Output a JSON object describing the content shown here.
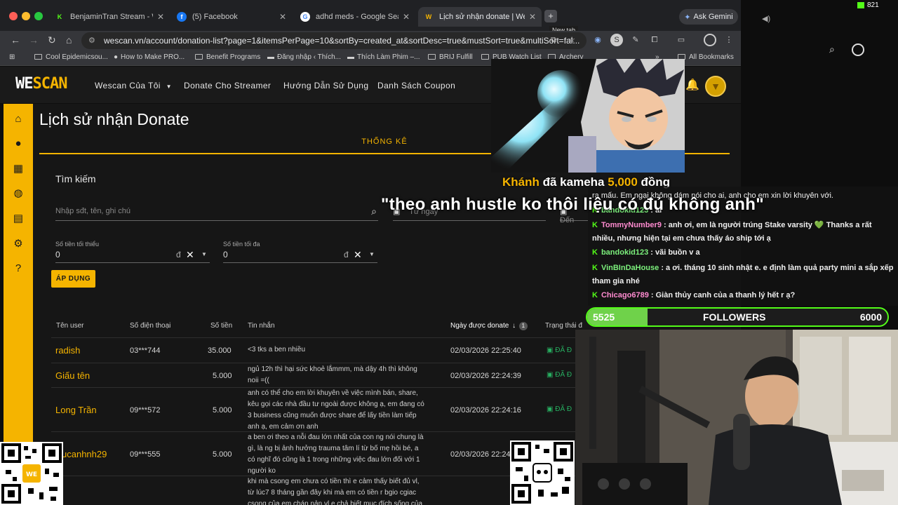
{
  "browser": {
    "tabs": [
      {
        "title": "BenjaminTran Stream - Watch",
        "favicon": "kick-icon",
        "color": "#53fc18"
      },
      {
        "title": "(5) Facebook",
        "favicon": "facebook-icon",
        "color": "#1877f2"
      },
      {
        "title": "adhd meds - Google Search",
        "favicon": "google-icon",
        "color": "#ffffff"
      },
      {
        "title": "Lịch sử nhận donate | WeScan",
        "favicon": "wescan-icon",
        "color": "#f5b400"
      }
    ],
    "new_tab_tooltip": "New tab",
    "gemini_label": "Ask Gemini",
    "url": "wescan.vn/account/donation-list?page=1&itemsPerPage=10&sortBy=created_at&sortDesc=true&mustSort=true&multiSort=fal...",
    "bookmarks": [
      "Cool Epidemicsou...",
      "How to Make PRO...",
      "Benefit Programs",
      "Đăng nhập ‹ Thích...",
      "Thích Làm Phim –...",
      "BRIJ Fulfill",
      "PUB Watch List",
      "Archery"
    ],
    "all_bookmarks": "All Bookmarks",
    "system_count": "821"
  },
  "site": {
    "logo_we": "WE",
    "logo_scan": "SCAN",
    "nav": [
      "Wescan Của Tôi",
      "Donate Cho Streamer",
      "Hướng Dẫn Sử Dụng",
      "Danh Sách Coupon"
    ],
    "page_title": "Lịch sử nhận Donate",
    "stats_tab": "THỐNG KÊ",
    "search_title": "Tìm kiếm",
    "search_placeholder": "Nhập sđt, tên, ghi chú",
    "from_date_placeholder": "Từ ngày",
    "to_date_placeholder": "Đến",
    "min_label": "Số tiền tối thiểu",
    "max_label": "Số tiền tối đa",
    "min_value": "0",
    "max_value": "0",
    "currency": "đ",
    "apply_label": "ÁP DỤNG",
    "columns": [
      "Tên user",
      "Số điện thoại",
      "Số tiền",
      "Tin nhắn",
      "Ngày được donate",
      "Trạng thái đ"
    ],
    "sort_badge": "1",
    "rows": [
      {
        "name": "radish",
        "phone": "03***744",
        "amount": "35.000",
        "message": [
          "<3 tks a ben nhiều"
        ],
        "date": "02/03/2026 22:25:40",
        "status": "ĐÃ Đ"
      },
      {
        "name": "Giấu tên",
        "phone": "",
        "amount": "5.000",
        "message": [
          "ngủ 12h thì hại sức khoẻ lắmmm, mà dậy 4h thì không",
          "noii =(("
        ],
        "date": "02/03/2026 22:24:39",
        "status": "ĐÃ Đ"
      },
      {
        "name": "Long Trần",
        "phone": "09***572",
        "amount": "5.000",
        "message": [
          "anh có thể cho em lời khuyên về việc mình bán, share,",
          "kêu gọi các nhà đầu tư ngoài được không ạ, em đang có",
          "3 business cũng muốn được share để lấy tiền làm tiếp",
          "anh ạ, em cảm ơn anh"
        ],
        "date": "02/03/2026 22:24:16",
        "status": "ĐÃ Đ"
      },
      {
        "name": "ucanhnh29",
        "phone": "09***555",
        "amount": "5.000",
        "message": [
          "a ben ơi theo a nỗi đau lớn nhất của con ng nói chung là",
          "gì, là ng bị ảnh hưởng trauma tâm lí từ bố mẹ hồi bé, a",
          "có nghĩ đó cũng là 1 trong những việc đau lớn đối với 1",
          "người ko"
        ],
        "date": "02/03/2026 22:24",
        "status": ""
      },
      {
        "name": "",
        "phone": "",
        "amount": "",
        "message": [
          "khi mà csong em chưa có tiền thì e cảm thấy biết đủ vl,",
          "từ lúc7 8 tháng gần đây khi mà em có tiền r bgio cgiac",
          "csong của em chán nản vl e chả biết mục đích sống của"
        ],
        "date": "",
        "status": ""
      }
    ]
  },
  "alert": {
    "user": "Khánh",
    "action": "đã kameha",
    "amount": "5,000",
    "unit": "đồng",
    "message": "\"theo anh hustle ko thôi liệu có đủ không anh\""
  },
  "chat": {
    "messages": [
      {
        "user": "",
        "text": "ra mấu. Em ngại không dám nói cho ai, anh cho em xin lời khuyên với."
      },
      {
        "user": "bandokid123",
        "text": ": ai"
      },
      {
        "user": "TommyNumber9",
        "text": ": anh ơi, em là người trúng Stake varsity 💚 Thanks a rất nhiều, nhưng hiện tại em chưa thấy áo ship tới ạ"
      },
      {
        "user": "bandokid123",
        "text": ": vãi buồn v a"
      },
      {
        "user": "VinBInDaHouse",
        "text": ": a ơi. tháng 10 sinh nhật e. e định làm quả party mini a sắp xếp tham gia nhé"
      },
      {
        "user": "Chicago6789",
        "text": ": Giàn thủy canh của a thanh lý hết r ạ?"
      }
    ]
  },
  "followers": {
    "current": "5525",
    "label": "FOLLOWERS",
    "goal": "6000",
    "progress": 0.2
  },
  "colors": {
    "brand": "#f5b400",
    "kick_green": "#53fc18",
    "status_green": "#27ae60"
  }
}
